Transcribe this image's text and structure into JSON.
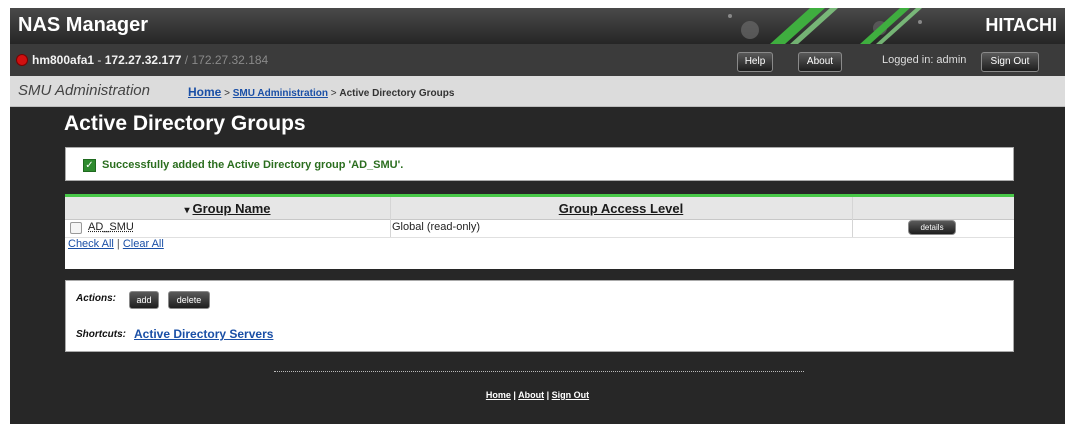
{
  "header": {
    "app_title": "NAS Manager",
    "brand": "HITACHI"
  },
  "host": {
    "name": "hm800afa1",
    "sep": " - ",
    "ip": "172.27.32.177",
    "alt_ip": " / 172.27.32.184"
  },
  "top_buttons": {
    "help": "Help",
    "about": "About",
    "logged_in": "Logged in: admin",
    "sign_out": "Sign Out"
  },
  "breadcrumb": {
    "section": "SMU Administration",
    "home": "Home",
    "sep": " > ",
    "admin": "SMU Administration",
    "current": "Active Directory Groups"
  },
  "page": {
    "title": "Active Directory Groups"
  },
  "message": {
    "text": "Successfully added the Active Directory group 'AD_SMU'."
  },
  "table": {
    "sort_indicator": "▾",
    "columns": {
      "name": "Group Name",
      "access": "Group Access Level"
    },
    "rows": [
      {
        "name": "AD_SMU",
        "access": "Global (read-only)",
        "action": "details"
      }
    ],
    "check_all": "Check All",
    "sep": " | ",
    "clear_all": "Clear All"
  },
  "actions": {
    "label": "Actions:",
    "add": "add",
    "delete": "delete"
  },
  "shortcuts": {
    "label": "Shortcuts:",
    "link": "Active Directory Servers"
  },
  "footer": {
    "home": "Home",
    "about": "About",
    "sign_out": "Sign Out",
    "sep": " | "
  },
  "colors": {
    "status_dot": "#d01010",
    "success_text": "#2b6e1f",
    "table_accent": "#48c848",
    "link": "#1a4fa6"
  },
  "icons": {
    "status": "status-dot-icon",
    "success": "checkbox-checked-icon",
    "sort": "sort-down-icon"
  }
}
